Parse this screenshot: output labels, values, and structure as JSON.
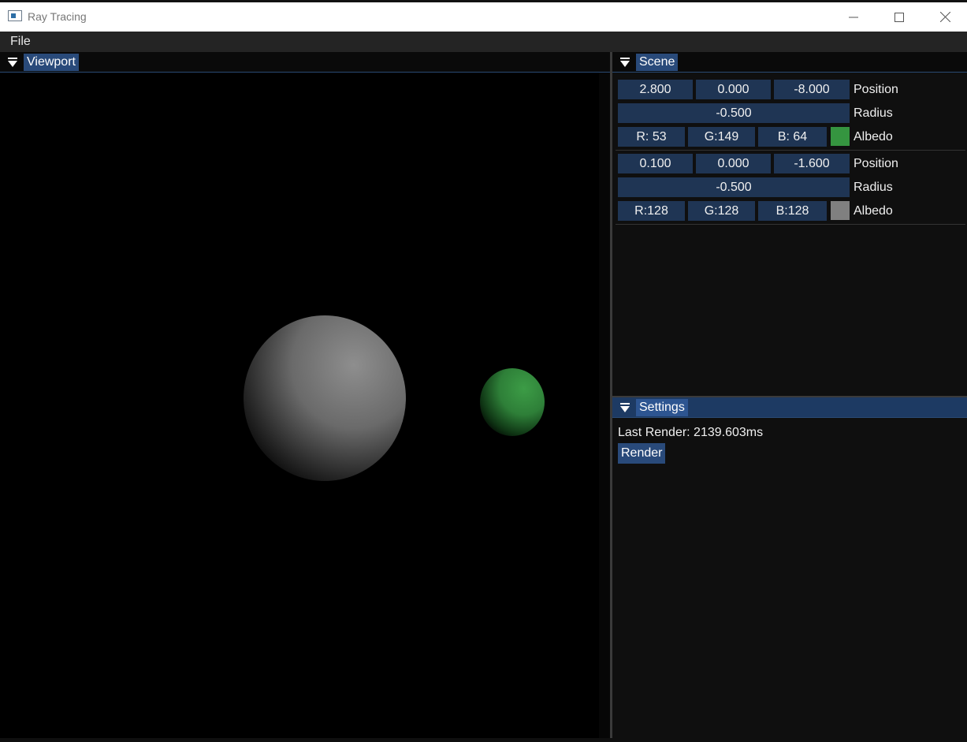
{
  "window": {
    "title": "Ray Tracing",
    "minimize": "—",
    "maximize": "☐",
    "close": "✕"
  },
  "menu": {
    "file": "File"
  },
  "viewport": {
    "tab": "Viewport"
  },
  "scene": {
    "tab": "Scene",
    "objects": [
      {
        "position": [
          "2.800",
          "0.000",
          "-8.000"
        ],
        "position_label": "Position",
        "radius": "-0.500",
        "radius_label": "Radius",
        "albedo": [
          "R: 53",
          "G:149",
          "B: 64"
        ],
        "albedo_label": "Albedo",
        "albedo_color": "#359540"
      },
      {
        "position": [
          "0.100",
          "0.000",
          "-1.600"
        ],
        "position_label": "Position",
        "radius": "-0.500",
        "radius_label": "Radius",
        "albedo": [
          "R:128",
          "G:128",
          "B:128"
        ],
        "albedo_label": "Albedo",
        "albedo_color": "#808080"
      }
    ]
  },
  "settings": {
    "tab": "Settings",
    "last_render": "Last Render: 2139.603ms",
    "render_button": "Render"
  }
}
